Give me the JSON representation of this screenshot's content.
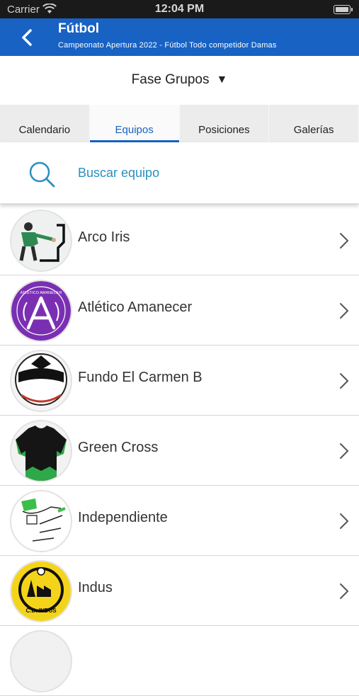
{
  "status": {
    "carrier": "Carrier",
    "time": "12:04 PM"
  },
  "header": {
    "title": "Fútbol",
    "subtitle": "Campeonato Apertura 2022 - Fútbol Todo competidor Damas"
  },
  "phase": {
    "label": "Fase Grupos",
    "caret": "▼"
  },
  "tabs": [
    {
      "label": "Calendario",
      "active": false
    },
    {
      "label": "Equipos",
      "active": true
    },
    {
      "label": "Posiciones",
      "active": false
    },
    {
      "label": "Galerías",
      "active": false
    }
  ],
  "search": {
    "placeholder": "Buscar equipo"
  },
  "teams": [
    {
      "name": "Arco Iris"
    },
    {
      "name": "Atlético Amanecer"
    },
    {
      "name": "Fundo El Carmen B"
    },
    {
      "name": "Green Cross"
    },
    {
      "name": "Independiente"
    },
    {
      "name": "Indus"
    }
  ],
  "logo_text": {
    "amanecer": "ATLÉTICO AMANECER",
    "indus": "C.D. INDUS"
  },
  "colors": {
    "header": "#1862c4",
    "accent": "#2a8fbf",
    "status_bar": "#1a1a1a"
  }
}
